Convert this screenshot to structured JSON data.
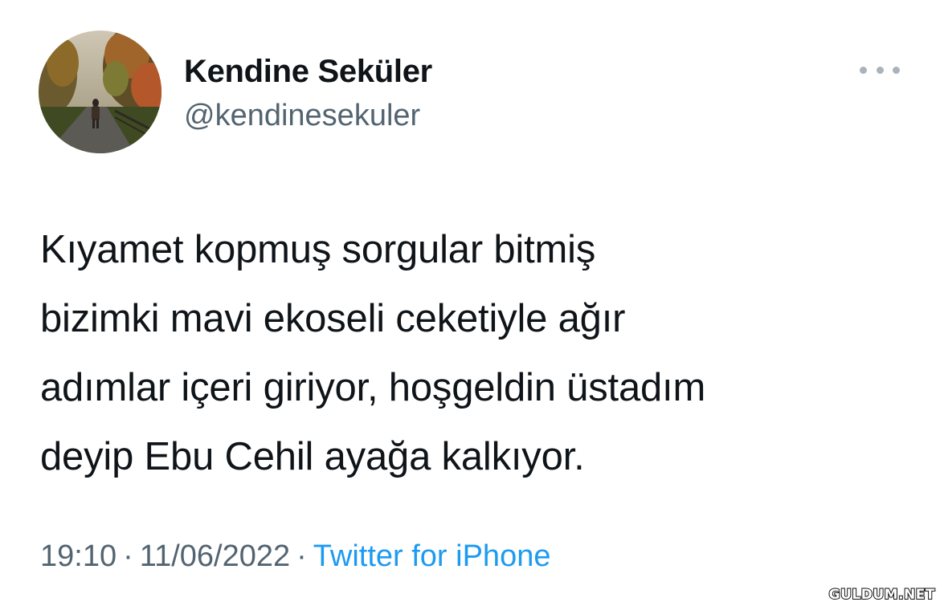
{
  "author": {
    "display_name": "Kendine Seküler",
    "handle": "@kendinesekuler"
  },
  "menu": {
    "icon": "more-horizontal-icon"
  },
  "tweet": {
    "lines": [
      "Kıyamet kopmuş sorgular bitmiş",
      "bizimki mavi ekoseli ceketiyle ağır",
      "adımlar içeri giriyor, hoşgeldin üstadım",
      "deyip Ebu Cehil ayağa kalkıyor."
    ]
  },
  "meta": {
    "time": "19:10",
    "separator": "·",
    "date": "11/06/2022",
    "source": "Twitter for iPhone"
  },
  "watermark": "GULDUM.NET",
  "colors": {
    "text": "#0f1419",
    "secondary": "#536471",
    "link": "#1d9bf0"
  }
}
